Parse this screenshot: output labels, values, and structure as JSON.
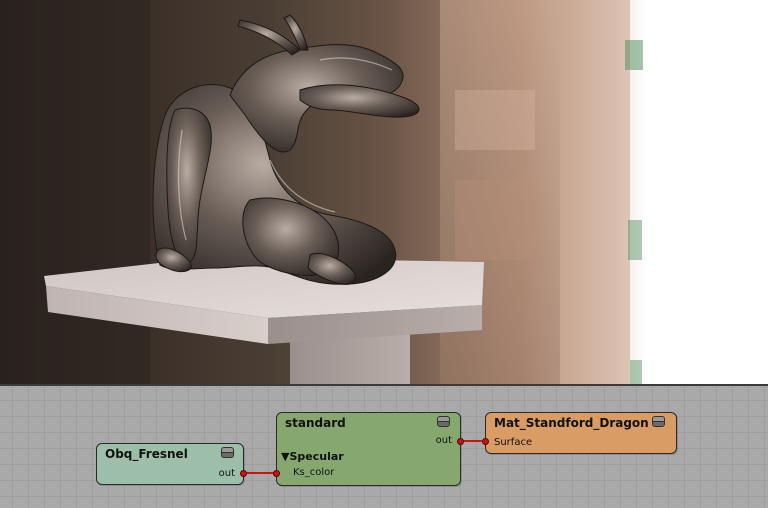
{
  "colors": {
    "fresnel_node": "#9dbfa9",
    "standard_node": "#86a86e",
    "material_node": "#d99c64",
    "wire": "#c81414",
    "grid_bg": "#a9a9a9"
  },
  "nodes": {
    "fresnel": {
      "title": "Obq_Fresnel",
      "out_label": "out"
    },
    "standard": {
      "title": "standard",
      "out_label": "out",
      "section_label": "▼Specular",
      "input_label": "Ks_color"
    },
    "material": {
      "title": "Mat_Standford_Dragon",
      "input_label": "Surface"
    }
  },
  "icons": {
    "collapse": "collapse-icon",
    "port": "port-dot-icon"
  }
}
